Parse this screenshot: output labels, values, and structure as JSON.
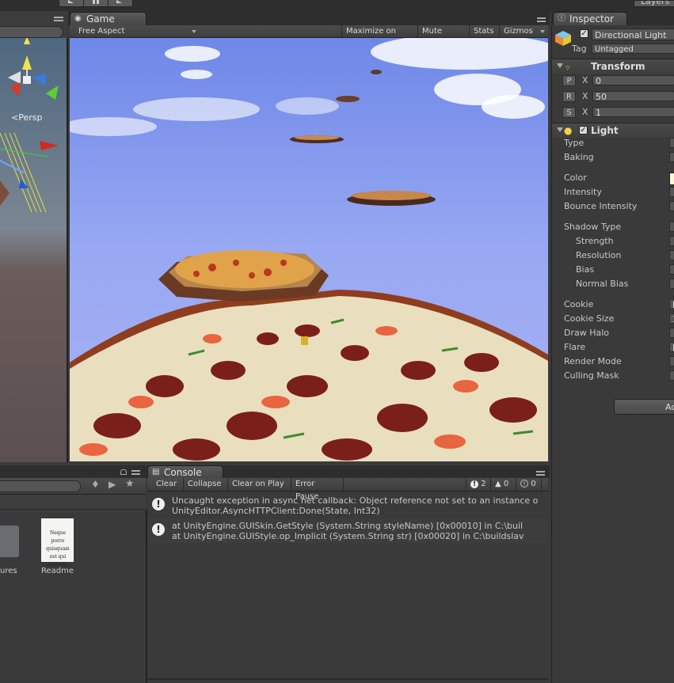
{
  "top": {
    "play_icon": "play-icon",
    "pause_icon": "pause-icon",
    "step_icon": "step-icon",
    "layers_label": "Layers"
  },
  "game_tab": {
    "label": "Game",
    "icon": "game-controller-icon"
  },
  "game_toolbar": {
    "aspect": "Free Aspect",
    "maximize": "Maximize on Play",
    "mute": "Mute audio",
    "stats": "Stats",
    "gizmos": "Gizmos"
  },
  "scene": {
    "persp_label": "<Persp",
    "gizmo_axis": "y"
  },
  "inspector": {
    "tab_label": "Inspector",
    "object_name": "Directional Light",
    "tag_label": "Tag",
    "tag_value": "Untagged",
    "transform": {
      "title": "Transform",
      "rows": [
        {
          "btn": "P",
          "axis": "X",
          "value": "0"
        },
        {
          "btn": "R",
          "axis": "X",
          "value": "50"
        },
        {
          "btn": "S",
          "axis": "X",
          "value": "1"
        }
      ]
    },
    "light": {
      "title": "Light",
      "props": [
        "Type",
        "Baking",
        "Color",
        "Intensity",
        "Bounce Intensity",
        "Shadow Type",
        "Strength",
        "Resolution",
        "Bias",
        "Normal Bias",
        "Cookie",
        "Cookie Size",
        "Draw Halo",
        "Flare",
        "Render Mode",
        "Culling Mask"
      ],
      "partial_values": {
        "cookie": "N",
        "cookie_size": "1",
        "flare": "N"
      }
    },
    "add_button": "Ad"
  },
  "project": {
    "items": [
      {
        "label": "ures"
      },
      {
        "label": "Readme",
        "thumb_text": "Neque porro quisquam est qui dolorem."
      }
    ]
  },
  "console": {
    "tab_label": "Console",
    "buttons": [
      "Clear",
      "Collapse",
      "Clear on Play",
      "Error Pause"
    ],
    "counts": {
      "errors": "2",
      "warnings": "0",
      "logs": "0"
    },
    "messages": [
      {
        "line1": "Uncaught exception in async net callback: Object reference not set to an instance o",
        "line2": "UnityEditor.AsyncHTTPClient:Done(State, Int32)"
      },
      {
        "line1": "  at UnityEngine.GUISkin.GetStyle (System.String styleName) [0x00010] in C:\\buil",
        "line2": "  at UnityEngine.GUIStyle.op_Implicit (System.String str) [0x00020] in C:\\buildslav"
      }
    ]
  }
}
